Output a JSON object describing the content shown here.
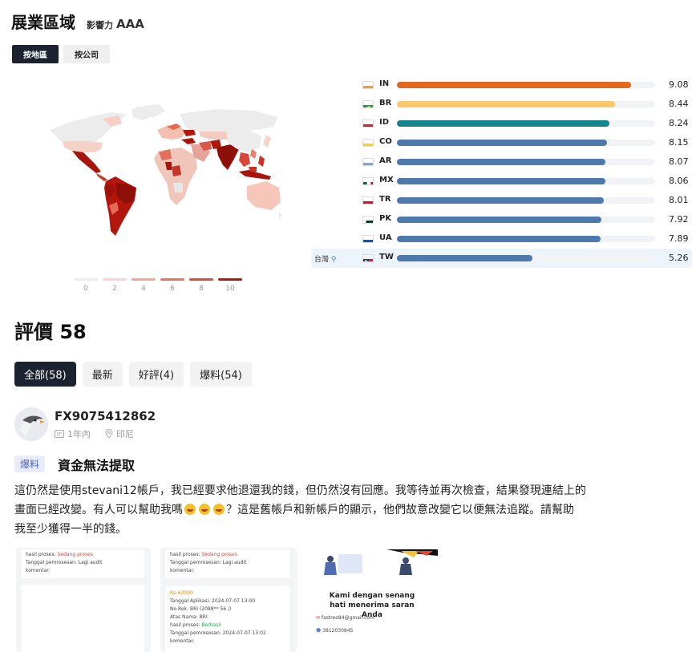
{
  "header": {
    "title": "展業區域",
    "influence_label": "影響力",
    "influence_value": "AAA"
  },
  "region_tabs": [
    {
      "label": "按地區",
      "active": true
    },
    {
      "label": "按公司",
      "active": false
    }
  ],
  "map_legend": [
    "0",
    "2",
    "4",
    "6",
    "8",
    "10"
  ],
  "map_legend_colors": [
    "#eeeeee",
    "#f9d4c9",
    "#f3a896",
    "#e8725e",
    "#d94a35",
    "#b3160c"
  ],
  "country_ranking": [
    {
      "code": "IN",
      "value": "9.08",
      "score": 9.08,
      "color": "#e2681e"
    },
    {
      "code": "BR",
      "value": "8.44",
      "score": 8.44,
      "color": "#f9c86b"
    },
    {
      "code": "ID",
      "value": "8.24",
      "score": 8.24,
      "color": "#15868f"
    },
    {
      "code": "CO",
      "value": "8.15",
      "score": 8.15,
      "color": "#4d79ad"
    },
    {
      "code": "AR",
      "value": "8.07",
      "score": 8.07,
      "color": "#4d79ad"
    },
    {
      "code": "MX",
      "value": "8.06",
      "score": 8.06,
      "color": "#4d79ad"
    },
    {
      "code": "TR",
      "value": "8.01",
      "score": 8.01,
      "color": "#4d79ad"
    },
    {
      "code": "PK",
      "value": "7.92",
      "score": 7.92,
      "color": "#4d79ad"
    },
    {
      "code": "UA",
      "value": "7.89",
      "score": 7.89,
      "color": "#4d79ad"
    },
    {
      "code": "TW",
      "value": "5.26",
      "score": 5.26,
      "color": "#4d79ad",
      "location_label": "台灣",
      "highlight": true
    }
  ],
  "reviews": {
    "title": "評價 58",
    "tabs": [
      {
        "label": "全部(58)",
        "active": true
      },
      {
        "label": "最新",
        "active": false
      },
      {
        "label": "好評(4)",
        "active": false
      },
      {
        "label": "爆料(54)",
        "active": false
      }
    ]
  },
  "review": {
    "username": "FX9075412862",
    "account_age": "1年內",
    "location": "印尼",
    "tag": "爆料",
    "title": "資金無法提取",
    "body_line1": "這仍然是使用stevani12帳戶，我已經要求他退還我的錢，但仍然沒有回應。我等待並再次檢查，結果發現連結上的",
    "body_line2_a": "畫面已經改變。有人可以幫助我嗎",
    "body_line2_b": "？這是舊帳戶和新帳戶的顯示，他們故意改變它以便無法追蹤。請幫助",
    "body_line3": "我至少獲得一半的錢。"
  },
  "attachments": {
    "a1": {
      "c1_l1a": "hasil proses:",
      "c1_l1b": "Sedang proses",
      "c1_l2": "Tanggal pemrosesan: Lagi audit",
      "c1_l3": "komentar:"
    },
    "a2": {
      "c1_l1a": "hasil proses:",
      "c1_l1b": "Sedang proses",
      "c1_l2": "Tanggal pemrosesan: Lagi audit",
      "c1_l3": "komentar:",
      "c2_amount": "Rp 63000",
      "c2_l1": "Tanggal Aplikasi: 2024-07-07 13:00",
      "c2_l2": "No.Rek: BRI (2088** 56 /)",
      "c2_l3": "Atas Nama: BRI",
      "c2_l4a": "hasil proses:",
      "c2_l4b": "Berhasil",
      "c2_l5": "Tanggal pemrosesan: 2024-07-07 13:02",
      "c2_l6": "komentar:"
    },
    "a3": {
      "heading": "Kami dengan senang hati menerima saran Anda",
      "email": "fastreo84@gmail.com",
      "phone": "3812030845"
    }
  }
}
